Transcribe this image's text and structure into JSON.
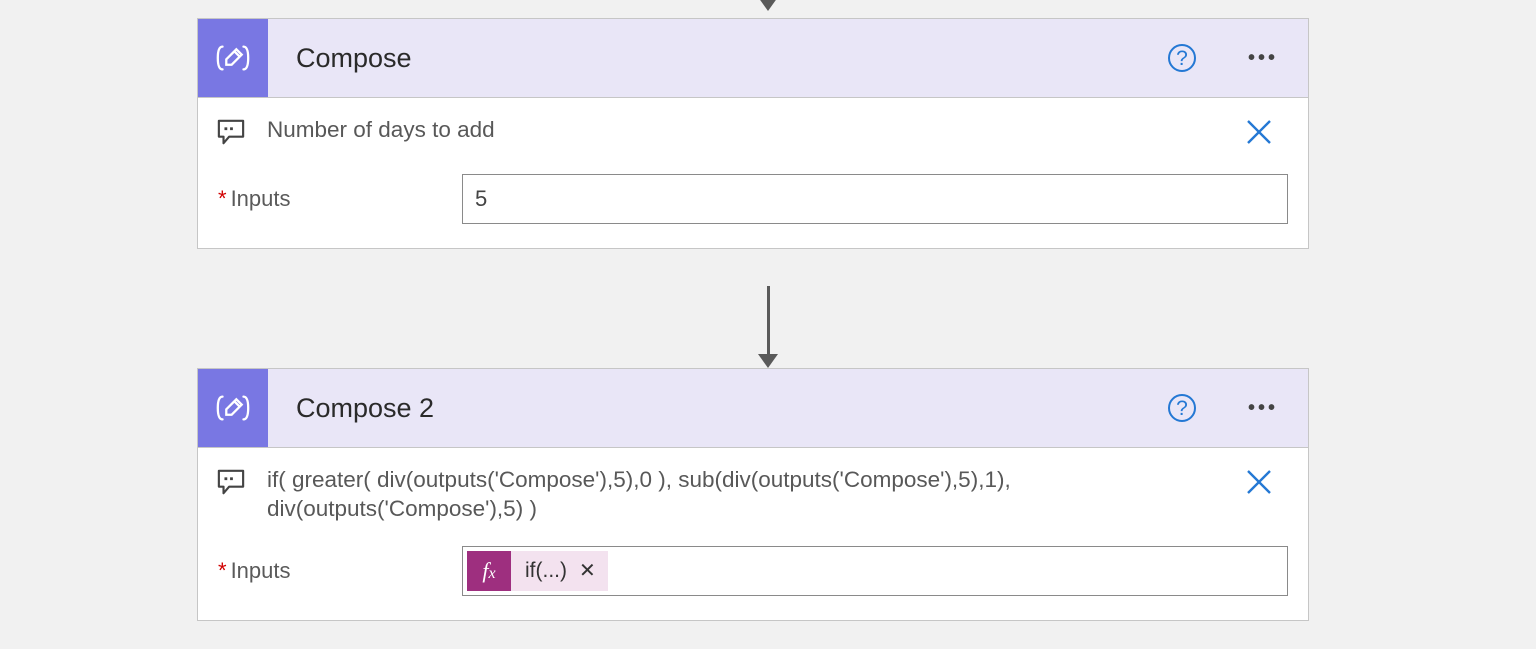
{
  "colors": {
    "action_icon_bg": "#7977e3",
    "header_bg": "#e9e6f7",
    "help_blue": "#2478d4",
    "close_blue": "#2478d4",
    "fx_magenta": "#9e2f7f",
    "token_bg": "#f3e2ef"
  },
  "card1": {
    "title": "Compose",
    "comment": "Number of days to add",
    "inputs_label": "Inputs",
    "inputs_value": "5"
  },
  "card2": {
    "title": "Compose 2",
    "comment": "if( greater( div(outputs('Compose'),5),0 ), sub(div(outputs('Compose'),5),1), div(outputs('Compose'),5) )",
    "inputs_label": "Inputs",
    "token_fx": "fx",
    "token_text": "if(...)"
  }
}
